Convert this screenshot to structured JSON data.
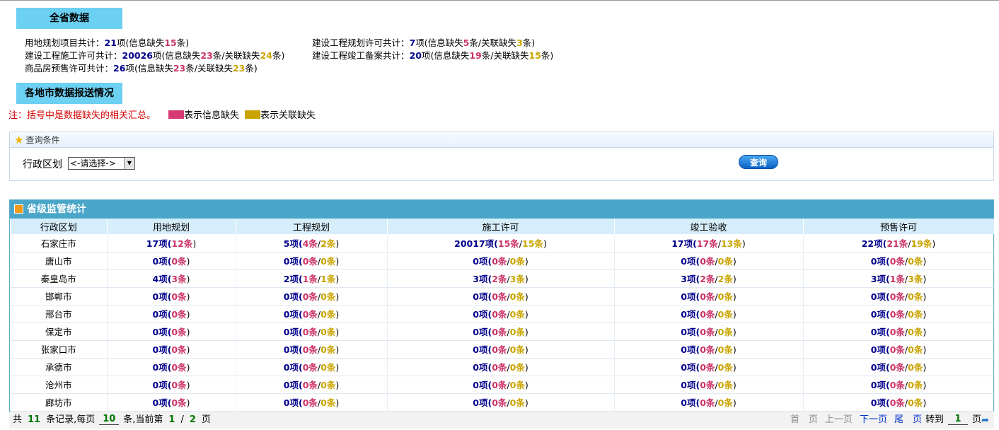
{
  "province": {
    "title": "全省数据",
    "stats": [
      {
        "label": "用地规划项目共计：",
        "count": "21",
        "unit": "项",
        "pre1": "(信息缺失",
        "miss": "15",
        "post1": "条)",
        "pre2": "",
        "rel": "",
        "post2": ""
      },
      {
        "label": "建设工程规划许可共计：",
        "count": "7",
        "unit": "项",
        "pre1": "(信息缺失",
        "miss": "5",
        "post1": "条",
        "pre2": "/关联缺失",
        "rel": "3",
        "post2": "条)"
      },
      {
        "label": "建设工程施工许可共计：",
        "count": "20026",
        "unit": "项",
        "pre1": "(信息缺失",
        "miss": "23",
        "post1": "条",
        "pre2": "/关联缺失",
        "rel": "24",
        "post2": "条)"
      },
      {
        "label": "建设工程竣工备案共计：",
        "count": "20",
        "unit": "项",
        "pre1": "(信息缺失",
        "miss": "19",
        "post1": "条",
        "pre2": "/关联缺失",
        "rel": "15",
        "post2": "条)"
      },
      {
        "label": "商品房预售许可共计：",
        "count": "26",
        "unit": "项",
        "pre1": "(信息缺失",
        "miss": "23",
        "post1": "条",
        "pre2": "/关联缺失",
        "rel": "23",
        "post2": "条)"
      }
    ]
  },
  "cities_title": "各地市数据报送情况",
  "note": {
    "text": "注：括号中是数据缺失的相关汇总。",
    "legend_missing": "表示信息缺失",
    "legend_related": "表示关联缺失",
    "color_missing": "#d63a74",
    "color_related": "#c9a400"
  },
  "query": {
    "header": "查询条件",
    "header_icon": "star-icon",
    "region_label": "行政区划",
    "region_value": "<-请选择->",
    "search_label": "查询"
  },
  "grid": {
    "title": "省级监管统计",
    "columns": [
      "行政区划",
      "用地规划",
      "工程规划",
      "施工许可",
      "竣工验收",
      "预售许可"
    ],
    "rows": [
      {
        "city": "石家庄市",
        "land": [
          "17",
          "12"
        ],
        "plan": [
          "5",
          "4",
          "2"
        ],
        "build": [
          "20017",
          "15",
          "15"
        ],
        "done": [
          "17",
          "17",
          "13"
        ],
        "sale": [
          "22",
          "21",
          "19"
        ]
      },
      {
        "city": "唐山市",
        "land": [
          "0",
          "0"
        ],
        "plan": [
          "0",
          "0",
          "0"
        ],
        "build": [
          "0",
          "0",
          "0"
        ],
        "done": [
          "0",
          "0",
          "0"
        ],
        "sale": [
          "0",
          "0",
          "0"
        ]
      },
      {
        "city": "秦皇岛市",
        "land": [
          "4",
          "3"
        ],
        "plan": [
          "2",
          "1",
          "1"
        ],
        "build": [
          "3",
          "2",
          "3"
        ],
        "done": [
          "3",
          "2",
          "2"
        ],
        "sale": [
          "3",
          "1",
          "3"
        ]
      },
      {
        "city": "邯郸市",
        "land": [
          "0",
          "0"
        ],
        "plan": [
          "0",
          "0",
          "0"
        ],
        "build": [
          "0",
          "0",
          "0"
        ],
        "done": [
          "0",
          "0",
          "0"
        ],
        "sale": [
          "0",
          "0",
          "0"
        ]
      },
      {
        "city": "邢台市",
        "land": [
          "0",
          "0"
        ],
        "plan": [
          "0",
          "0",
          "0"
        ],
        "build": [
          "0",
          "0",
          "0"
        ],
        "done": [
          "0",
          "0",
          "0"
        ],
        "sale": [
          "0",
          "0",
          "0"
        ]
      },
      {
        "city": "保定市",
        "land": [
          "0",
          "0"
        ],
        "plan": [
          "0",
          "0",
          "0"
        ],
        "build": [
          "0",
          "0",
          "0"
        ],
        "done": [
          "0",
          "0",
          "0"
        ],
        "sale": [
          "0",
          "0",
          "0"
        ]
      },
      {
        "city": "张家口市",
        "land": [
          "0",
          "0"
        ],
        "plan": [
          "0",
          "0",
          "0"
        ],
        "build": [
          "0",
          "0",
          "0"
        ],
        "done": [
          "0",
          "0",
          "0"
        ],
        "sale": [
          "0",
          "0",
          "0"
        ]
      },
      {
        "city": "承德市",
        "land": [
          "0",
          "0"
        ],
        "plan": [
          "0",
          "0",
          "0"
        ],
        "build": [
          "0",
          "0",
          "0"
        ],
        "done": [
          "0",
          "0",
          "0"
        ],
        "sale": [
          "0",
          "0",
          "0"
        ]
      },
      {
        "city": "沧州市",
        "land": [
          "0",
          "0"
        ],
        "plan": [
          "0",
          "0",
          "0"
        ],
        "build": [
          "0",
          "0",
          "0"
        ],
        "done": [
          "0",
          "0",
          "0"
        ],
        "sale": [
          "0",
          "0",
          "0"
        ]
      },
      {
        "city": "廊坊市",
        "land": [
          "0",
          "0"
        ],
        "plan": [
          "0",
          "0",
          "0"
        ],
        "build": [
          "0",
          "0",
          "0"
        ],
        "done": [
          "0",
          "0",
          "0"
        ],
        "sale": [
          "0",
          "0",
          "0"
        ]
      }
    ]
  },
  "pager": {
    "total_pre": "共",
    "total": "11",
    "per_page_pre": "条记录,每页",
    "per_page": "10",
    "current_pre": "条,当前第",
    "current": "1",
    "sep": "/",
    "pages": "2",
    "pages_post": "页",
    "first": "首　页",
    "prev": "上一页",
    "next": "下一页",
    "last": "尾　页",
    "goto_pre": "转到",
    "goto_value": "1",
    "goto_post": "页",
    "go_icon": "go-arrow-icon"
  }
}
